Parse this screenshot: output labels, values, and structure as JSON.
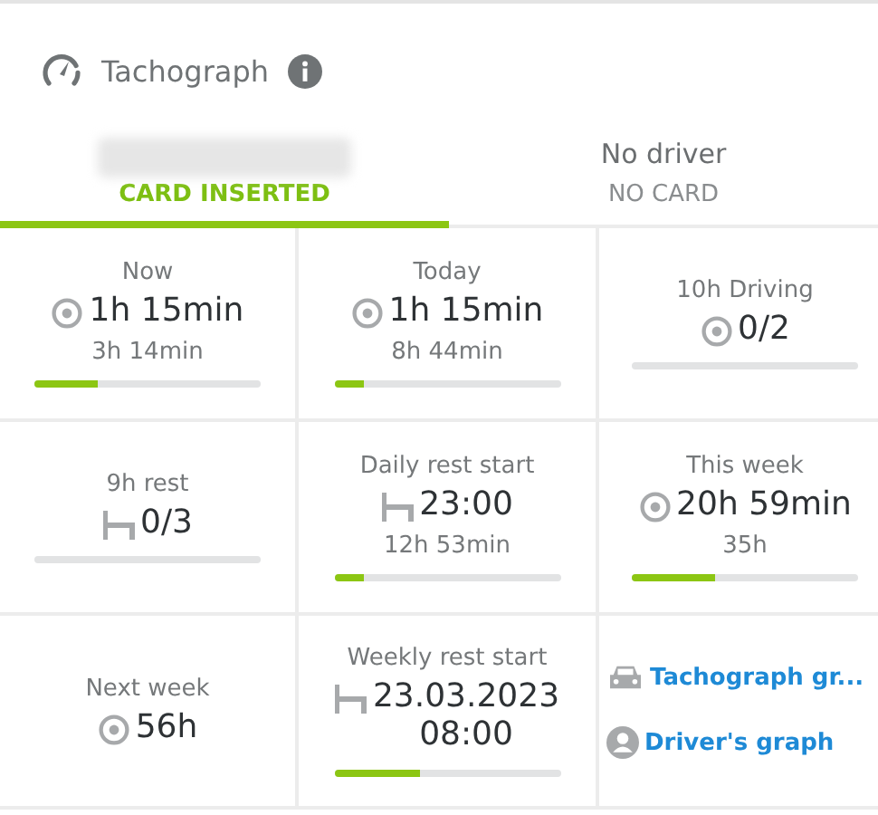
{
  "header": {
    "title": "Tachograph"
  },
  "tabs": [
    {
      "status": "CARD INSERTED",
      "selected": true
    },
    {
      "name": "No driver",
      "status": "NO CARD",
      "selected": false
    }
  ],
  "cells": [
    {
      "kind": "driving",
      "label": "Now",
      "value": "1h 15min",
      "sub": "3h 14min",
      "level": 0.28
    },
    {
      "kind": "driving",
      "label": "Today",
      "value": "1h 15min",
      "sub": "8h 44min",
      "level": 0.13
    },
    {
      "kind": "driving",
      "label": "10h Driving",
      "value": "0/2"
    },
    {
      "kind": "rest",
      "label": "9h rest",
      "value": "0/3"
    },
    {
      "kind": "rest",
      "label": "Daily rest start",
      "value": "23:00",
      "sub": "12h 53min",
      "level": 0.13
    },
    {
      "kind": "driving",
      "label": "This week",
      "value": "20h 59min",
      "sub": "35h",
      "level": 0.37
    },
    {
      "kind": "driving",
      "label": "Next week",
      "value": "56h",
      "bar": false
    },
    {
      "kind": "rest",
      "label": "Weekly rest start",
      "value": "23.03.2023\n08:00",
      "level": 0.38
    },
    {
      "kind": "links",
      "links": [
        {
          "kind": "vehicle",
          "text": "Tachograph gr..."
        },
        {
          "kind": "driver",
          "text": "Driver's graph"
        }
      ]
    }
  ]
}
